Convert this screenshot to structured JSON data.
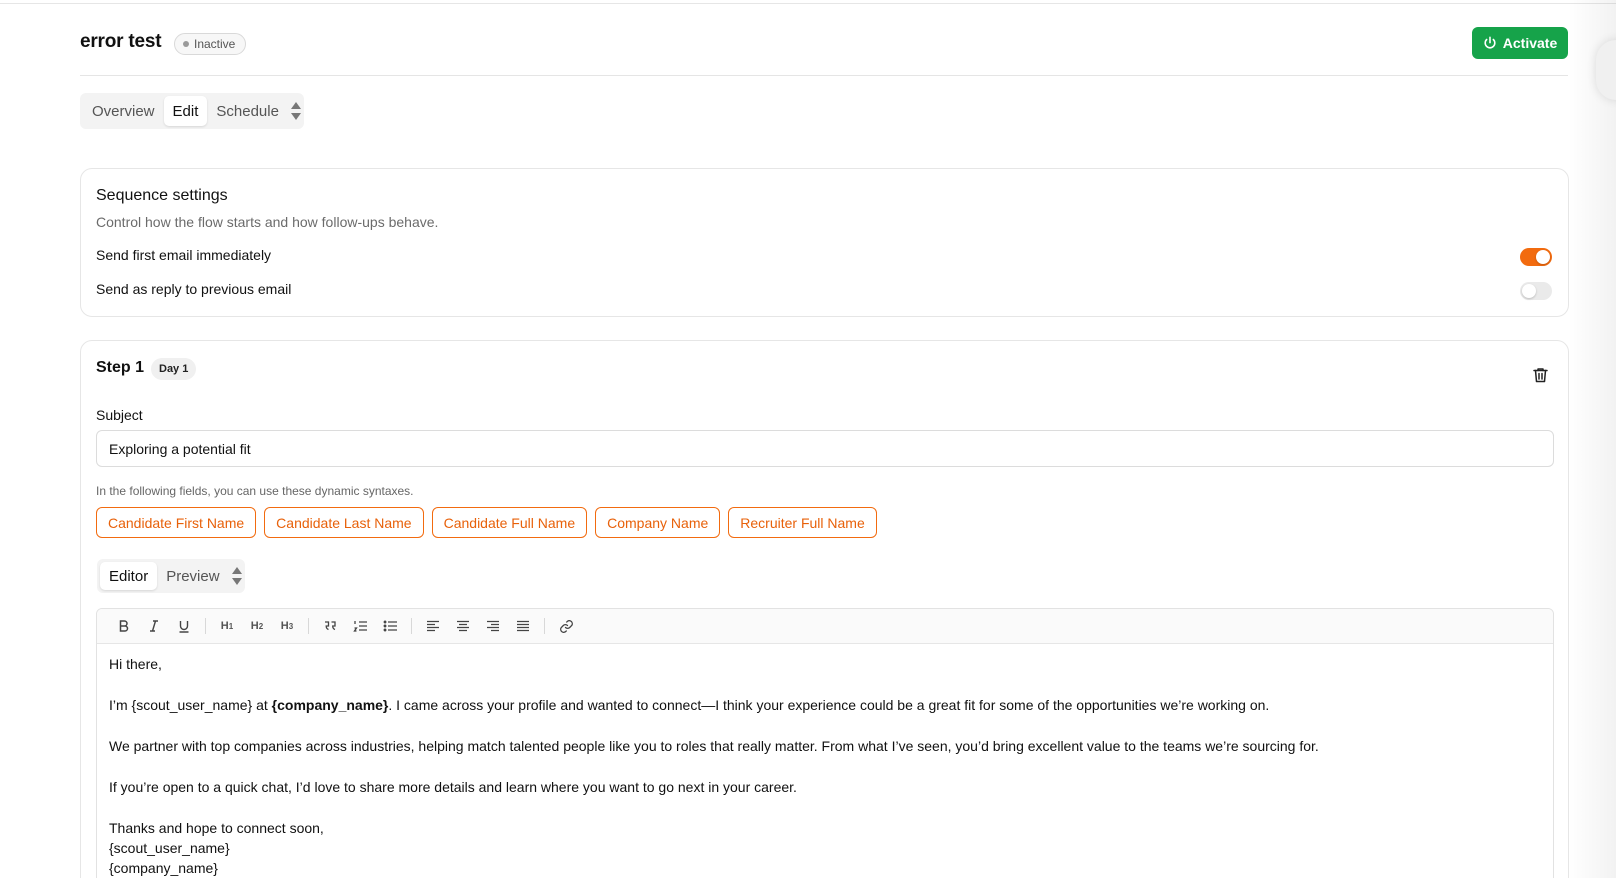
{
  "header": {
    "title": "error test",
    "status": "Inactive",
    "activate_label": "Activate"
  },
  "tabs": [
    {
      "label": "Overview",
      "active": false
    },
    {
      "label": "Edit",
      "active": true
    },
    {
      "label": "Schedule",
      "active": false
    }
  ],
  "settings": {
    "title": "Sequence settings",
    "description": "Control how the flow starts and how follow-ups behave.",
    "rows": [
      {
        "label": "Send first email immediately",
        "enabled": true
      },
      {
        "label": "Send as reply to previous email",
        "enabled": false
      }
    ]
  },
  "step": {
    "title": "Step 1",
    "day": "Day 1",
    "subject_label": "Subject",
    "subject_value": "Exploring a potential fit",
    "hint": "In the following fields, you can use these dynamic syntaxes.",
    "chips": [
      "Candidate First Name",
      "Candidate Last Name",
      "Candidate Full Name",
      "Company Name",
      "Recruiter Full Name"
    ],
    "editor_tabs": [
      {
        "label": "Editor",
        "active": true
      },
      {
        "label": "Preview",
        "active": false
      }
    ],
    "body": {
      "greeting": "Hi there,",
      "p1_pre": "I’m {scout_user_name} at ",
      "p1_bold": "{company_name}",
      "p1_post": ". I came across your profile and wanted to connect—I think your experience could be a great fit for some of the opportunities we’re working on.",
      "p2": "We partner with top companies across industries, helping match talented people like you to roles that really matter. From what I’ve seen, you’d bring excellent value to the teams we’re sourcing for.",
      "p3": "If you’re open to a quick chat, I’d love to share more details and learn where you want to go next in your career.",
      "signoff": "Thanks and hope to connect soon,",
      "sig_name": "{scout_user_name}",
      "sig_company": "{company_name}"
    }
  },
  "colors": {
    "accent": "#f26b0f",
    "activate": "#16a34a"
  }
}
